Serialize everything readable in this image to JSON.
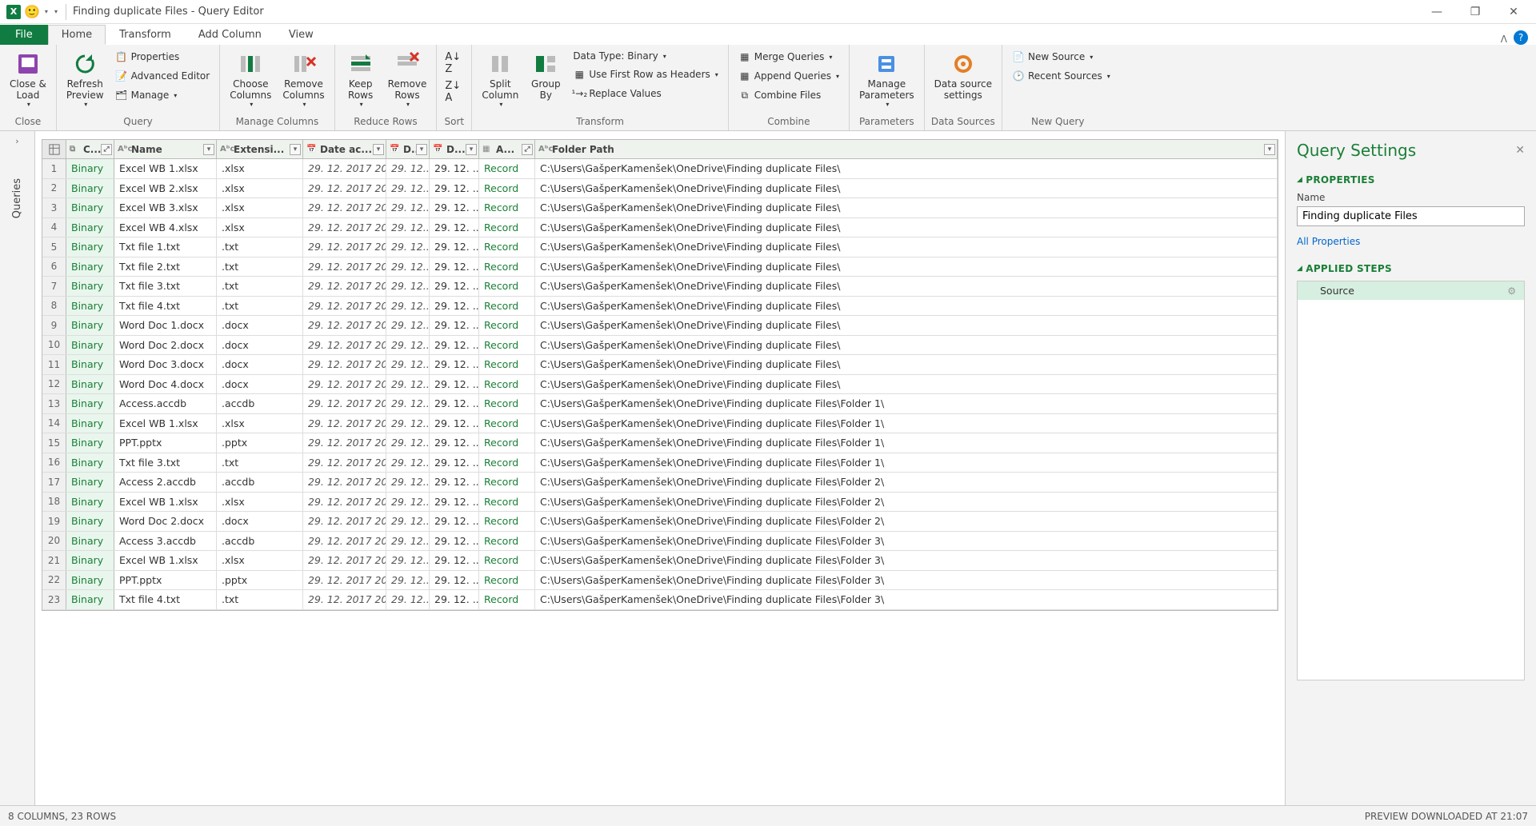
{
  "titlebar": {
    "title": "Finding duplicate Files - Query Editor"
  },
  "tabs": {
    "file": "File",
    "items": [
      "Home",
      "Transform",
      "Add Column",
      "View"
    ],
    "active": 0
  },
  "ribbon": {
    "close": {
      "close_load": "Close &\nLoad",
      "group": "Close"
    },
    "query": {
      "refresh": "Refresh\nPreview",
      "properties": "Properties",
      "advanced": "Advanced Editor",
      "manage": "Manage",
      "group": "Query"
    },
    "managecols": {
      "choose": "Choose\nColumns",
      "remove": "Remove\nColumns",
      "group": "Manage Columns"
    },
    "reduce": {
      "keep": "Keep\nRows",
      "remove": "Remove\nRows",
      "group": "Reduce Rows"
    },
    "sort": {
      "group": "Sort"
    },
    "transform": {
      "split": "Split\nColumn",
      "groupby": "Group\nBy",
      "datatype": "Data Type: Binary",
      "firstrow": "Use First Row as Headers",
      "replace": "Replace Values",
      "group": "Transform"
    },
    "combine": {
      "merge": "Merge Queries",
      "append": "Append Queries",
      "combine": "Combine Files",
      "group": "Combine"
    },
    "params": {
      "manage": "Manage\nParameters",
      "group": "Parameters"
    },
    "datasrc": {
      "settings": "Data source\nsettings",
      "group": "Data Sources"
    },
    "newquery": {
      "newsrc": "New Source",
      "recent": "Recent Sources",
      "group": "New Query"
    }
  },
  "leftedge": {
    "label": "Queries"
  },
  "grid": {
    "headers": {
      "content": "C...",
      "name": "Name",
      "ext": "Extensi...",
      "dateacc": "Date ac...",
      "d1": "D...",
      "d2": "D...",
      "attr": "A...",
      "path": "Folder Path"
    },
    "rows": [
      {
        "content": "Binary",
        "name": "Excel WB 1.xlsx",
        "ext": ".xlsx",
        "dateacc": "29. 12. 2017 20...",
        "d1": "29. 12....",
        "d2": "29. 12. ...",
        "attr": "Record",
        "path": "C:\\Users\\GašperKamenšek\\OneDrive\\Finding duplicate Files\\"
      },
      {
        "content": "Binary",
        "name": "Excel WB 2.xlsx",
        "ext": ".xlsx",
        "dateacc": "29. 12. 2017 20...",
        "d1": "29. 12....",
        "d2": "29. 12. ...",
        "attr": "Record",
        "path": "C:\\Users\\GašperKamenšek\\OneDrive\\Finding duplicate Files\\"
      },
      {
        "content": "Binary",
        "name": "Excel WB 3.xlsx",
        "ext": ".xlsx",
        "dateacc": "29. 12. 2017 20...",
        "d1": "29. 12....",
        "d2": "29. 12. ...",
        "attr": "Record",
        "path": "C:\\Users\\GašperKamenšek\\OneDrive\\Finding duplicate Files\\"
      },
      {
        "content": "Binary",
        "name": "Excel WB 4.xlsx",
        "ext": ".xlsx",
        "dateacc": "29. 12. 2017 20...",
        "d1": "29. 12....",
        "d2": "29. 12. ...",
        "attr": "Record",
        "path": "C:\\Users\\GašperKamenšek\\OneDrive\\Finding duplicate Files\\"
      },
      {
        "content": "Binary",
        "name": "Txt file 1.txt",
        "ext": ".txt",
        "dateacc": "29. 12. 2017 20...",
        "d1": "29. 12....",
        "d2": "29. 12. ...",
        "attr": "Record",
        "path": "C:\\Users\\GašperKamenšek\\OneDrive\\Finding duplicate Files\\"
      },
      {
        "content": "Binary",
        "name": "Txt file 2.txt",
        "ext": ".txt",
        "dateacc": "29. 12. 2017 20...",
        "d1": "29. 12....",
        "d2": "29. 12. ...",
        "attr": "Record",
        "path": "C:\\Users\\GašperKamenšek\\OneDrive\\Finding duplicate Files\\"
      },
      {
        "content": "Binary",
        "name": "Txt file 3.txt",
        "ext": ".txt",
        "dateacc": "29. 12. 2017 20...",
        "d1": "29. 12....",
        "d2": "29. 12. ...",
        "attr": "Record",
        "path": "C:\\Users\\GašperKamenšek\\OneDrive\\Finding duplicate Files\\"
      },
      {
        "content": "Binary",
        "name": "Txt file 4.txt",
        "ext": ".txt",
        "dateacc": "29. 12. 2017 20...",
        "d1": "29. 12....",
        "d2": "29. 12. ...",
        "attr": "Record",
        "path": "C:\\Users\\GašperKamenšek\\OneDrive\\Finding duplicate Files\\"
      },
      {
        "content": "Binary",
        "name": "Word Doc 1.docx",
        "ext": ".docx",
        "dateacc": "29. 12. 2017 20...",
        "d1": "29. 12....",
        "d2": "29. 12. ...",
        "attr": "Record",
        "path": "C:\\Users\\GašperKamenšek\\OneDrive\\Finding duplicate Files\\"
      },
      {
        "content": "Binary",
        "name": "Word Doc 2.docx",
        "ext": ".docx",
        "dateacc": "29. 12. 2017 20...",
        "d1": "29. 12....",
        "d2": "29. 12. ...",
        "attr": "Record",
        "path": "C:\\Users\\GašperKamenšek\\OneDrive\\Finding duplicate Files\\"
      },
      {
        "content": "Binary",
        "name": "Word Doc 3.docx",
        "ext": ".docx",
        "dateacc": "29. 12. 2017 20...",
        "d1": "29. 12....",
        "d2": "29. 12. ...",
        "attr": "Record",
        "path": "C:\\Users\\GašperKamenšek\\OneDrive\\Finding duplicate Files\\"
      },
      {
        "content": "Binary",
        "name": "Word Doc 4.docx",
        "ext": ".docx",
        "dateacc": "29. 12. 2017 20...",
        "d1": "29. 12....",
        "d2": "29. 12. ...",
        "attr": "Record",
        "path": "C:\\Users\\GašperKamenšek\\OneDrive\\Finding duplicate Files\\"
      },
      {
        "content": "Binary",
        "name": "Access.accdb",
        "ext": ".accdb",
        "dateacc": "29. 12. 2017 20...",
        "d1": "29. 12....",
        "d2": "29. 12. ...",
        "attr": "Record",
        "path": "C:\\Users\\GašperKamenšek\\OneDrive\\Finding duplicate Files\\Folder 1\\"
      },
      {
        "content": "Binary",
        "name": "Excel WB 1.xlsx",
        "ext": ".xlsx",
        "dateacc": "29. 12. 2017 20...",
        "d1": "29. 12....",
        "d2": "29. 12. ...",
        "attr": "Record",
        "path": "C:\\Users\\GašperKamenšek\\OneDrive\\Finding duplicate Files\\Folder 1\\"
      },
      {
        "content": "Binary",
        "name": "PPT.pptx",
        "ext": ".pptx",
        "dateacc": "29. 12. 2017 20...",
        "d1": "29. 12....",
        "d2": "29. 12. ...",
        "attr": "Record",
        "path": "C:\\Users\\GašperKamenšek\\OneDrive\\Finding duplicate Files\\Folder 1\\"
      },
      {
        "content": "Binary",
        "name": "Txt file 3.txt",
        "ext": ".txt",
        "dateacc": "29. 12. 2017 20...",
        "d1": "29. 12....",
        "d2": "29. 12. ...",
        "attr": "Record",
        "path": "C:\\Users\\GašperKamenšek\\OneDrive\\Finding duplicate Files\\Folder 1\\"
      },
      {
        "content": "Binary",
        "name": "Access 2.accdb",
        "ext": ".accdb",
        "dateacc": "29. 12. 2017 20...",
        "d1": "29. 12....",
        "d2": "29. 12. ...",
        "attr": "Record",
        "path": "C:\\Users\\GašperKamenšek\\OneDrive\\Finding duplicate Files\\Folder 2\\"
      },
      {
        "content": "Binary",
        "name": "Excel WB 1.xlsx",
        "ext": ".xlsx",
        "dateacc": "29. 12. 2017 20...",
        "d1": "29. 12....",
        "d2": "29. 12. ...",
        "attr": "Record",
        "path": "C:\\Users\\GašperKamenšek\\OneDrive\\Finding duplicate Files\\Folder 2\\"
      },
      {
        "content": "Binary",
        "name": "Word Doc 2.docx",
        "ext": ".docx",
        "dateacc": "29. 12. 2017 20...",
        "d1": "29. 12....",
        "d2": "29. 12. ...",
        "attr": "Record",
        "path": "C:\\Users\\GašperKamenšek\\OneDrive\\Finding duplicate Files\\Folder 2\\"
      },
      {
        "content": "Binary",
        "name": "Access 3.accdb",
        "ext": ".accdb",
        "dateacc": "29. 12. 2017 20...",
        "d1": "29. 12....",
        "d2": "29. 12. ...",
        "attr": "Record",
        "path": "C:\\Users\\GašperKamenšek\\OneDrive\\Finding duplicate Files\\Folder 3\\"
      },
      {
        "content": "Binary",
        "name": "Excel WB 1.xlsx",
        "ext": ".xlsx",
        "dateacc": "29. 12. 2017 20...",
        "d1": "29. 12....",
        "d2": "29. 12. ...",
        "attr": "Record",
        "path": "C:\\Users\\GašperKamenšek\\OneDrive\\Finding duplicate Files\\Folder 3\\"
      },
      {
        "content": "Binary",
        "name": "PPT.pptx",
        "ext": ".pptx",
        "dateacc": "29. 12. 2017 20...",
        "d1": "29. 12....",
        "d2": "29. 12. ...",
        "attr": "Record",
        "path": "C:\\Users\\GašperKamenšek\\OneDrive\\Finding duplicate Files\\Folder 3\\"
      },
      {
        "content": "Binary",
        "name": "Txt file 4.txt",
        "ext": ".txt",
        "dateacc": "29. 12. 2017 20...",
        "d1": "29. 12....",
        "d2": "29. 12. ...",
        "attr": "Record",
        "path": "C:\\Users\\GašperKamenšek\\OneDrive\\Finding duplicate Files\\Folder 3\\"
      }
    ]
  },
  "rightpanel": {
    "title": "Query Settings",
    "properties": "PROPERTIES",
    "name_label": "Name",
    "name_value": "Finding duplicate Files",
    "all_props": "All Properties",
    "applied": "APPLIED STEPS",
    "steps": [
      "Source"
    ]
  },
  "status": {
    "left": "8 COLUMNS, 23 ROWS",
    "right": "PREVIEW DOWNLOADED AT 21:07"
  }
}
